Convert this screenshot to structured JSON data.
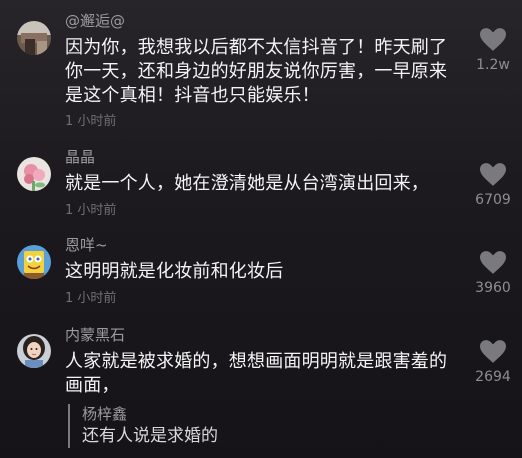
{
  "comments": [
    {
      "username": "@邂逅@",
      "text": "因为你，我想我以后都不太信抖音了！昨天刷了你一天，还和身边的好朋友说你厉害，一早原来是这个真相！抖音也只能娱乐！",
      "time": "1 小时前",
      "likes": "1.2w",
      "avatar_icon": "avatar-photo-icon"
    },
    {
      "username": "晶晶",
      "text": "就是一个人，她在澄清她是从台湾演出回来，",
      "time": "1 小时前",
      "likes": "6709",
      "avatar_icon": "avatar-flower-icon"
    },
    {
      "username": "恩咩~",
      "text": "这明明就是化妆前和化妆后",
      "time": "1 小时前",
      "likes": "3960",
      "avatar_icon": "avatar-sponge-icon"
    },
    {
      "username": "内蒙黑石",
      "text": "人家就是被求婚的，想想画面明明就是跟害羞的画面，",
      "likes": "2694",
      "avatar_icon": "avatar-girl-icon",
      "reply": {
        "username": "杨梓鑫",
        "text": "还有人说是求婚的"
      }
    }
  ],
  "colors": {
    "background": "#1c1a1e",
    "text": "#f4f4f4",
    "username": "#9a9aa0",
    "time": "#6e6e72",
    "heart": "#7a7a7e"
  }
}
